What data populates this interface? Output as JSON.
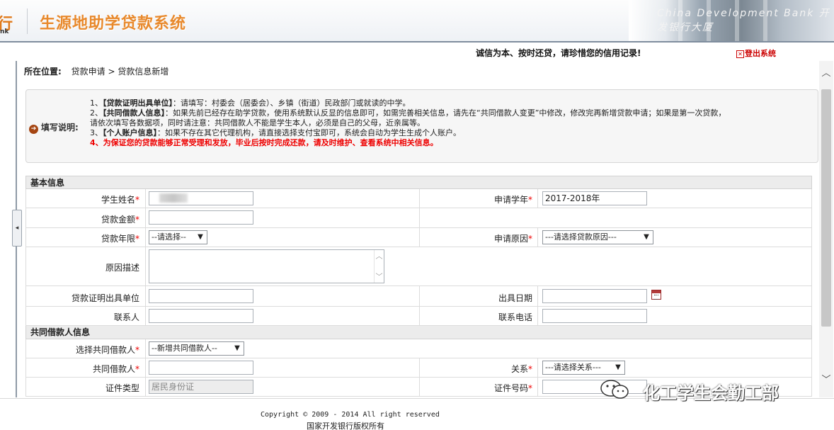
{
  "header": {
    "bank_logo": "行",
    "bank_sub": "nk",
    "system_title": "生源地助学贷款系统",
    "building_text": "China Development Bank 开发银行大厦"
  },
  "top": {
    "slogan": "诚信为本、按时还贷，请珍惜您的信用记录!",
    "logout": "登出系统"
  },
  "breadcrumb": {
    "label": "所在位置:",
    "path": "贷款申请 > 贷款信息新增"
  },
  "notice": {
    "title": "填写说明:",
    "lines": [
      {
        "prefix": "1、",
        "strong": "【贷款证明出具单位】",
        "text": "：请填写：村委会（居委会）、乡镇（街道）民政部门或就读的中学。"
      },
      {
        "prefix": "2、",
        "strong": "【共同借款人信息】",
        "text": "：如果先前已经存在助学贷款，使用系统默认反显的信息即可，如需完善相关信息，请先在“共同借款人变更”中修改，修改完再新增贷款申请；如果是第一次贷款，"
      },
      {
        "prefix": "",
        "strong": "",
        "text": "请依次填写各数据项，同时请注意：共同借款人不能是学生本人，必须是自己的父母，近亲属等。"
      },
      {
        "prefix": "3、",
        "strong": "【个人账户信息】",
        "text": "：如果不存在其它代理机构，请直接选择支付宝即可，系统会自动为学生生成个人账户。"
      },
      {
        "prefix": "",
        "strong": "",
        "text": "4、为保证您的贷款能够正常受理和发放，毕业后按时完成还款，请及时维护、查看系统中相关信息。"
      }
    ]
  },
  "basic": {
    "section": "基本信息",
    "student_name": "学生姓名",
    "school_year": "申请学年",
    "school_year_value": "2017-2018年",
    "loan_amount": "贷款金额",
    "loan_term": "贷款年限",
    "loan_term_value": "--请选择--",
    "reason": "申请原因",
    "reason_value": "---请选择贷款原因---",
    "reason_desc": "原因描述",
    "cert_unit": "贷款证明出具单位",
    "issue_date": "出具日期",
    "contact": "联系人",
    "phone": "联系电话"
  },
  "coborrower": {
    "section": "共同借款人信息",
    "select_label": "选择共同借款人",
    "select_value": "--新增共同借款人--",
    "name_label": "共同借款人",
    "relation_label": "关系",
    "relation_value": "---请选择关系---",
    "id_type_label": "证件类型",
    "id_type_value": "居民身份证",
    "id_no_label": "证件号码"
  },
  "footer": {
    "copyright": "Copyright © 2009 - 2014 All right reserved",
    "owner": "国家开发银行版权所有"
  },
  "watermark": "化工学生会勤工部",
  "colors": {
    "title_orange": "#e8892c",
    "required_red": "#e00000",
    "logout_red": "#cc0000"
  }
}
